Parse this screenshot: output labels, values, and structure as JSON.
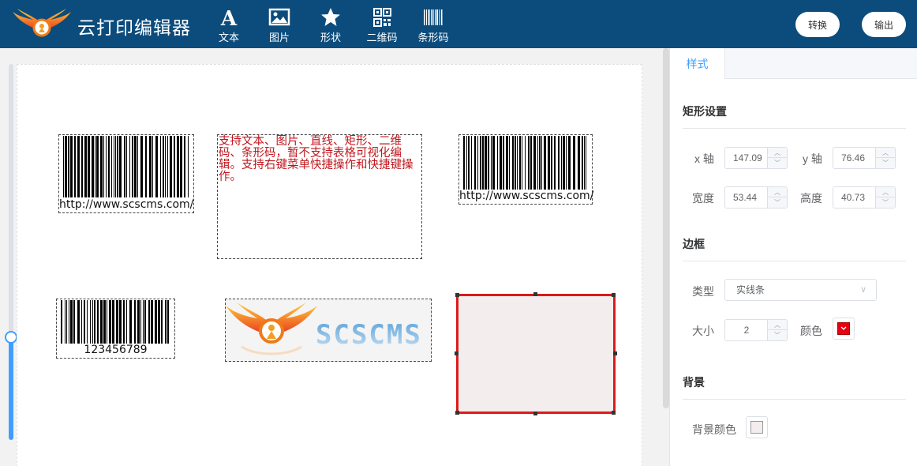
{
  "header": {
    "title": "云打印编辑器",
    "logo_icon": "winged-logo-icon",
    "tools": [
      {
        "label": "文本",
        "icon": "text-icon"
      },
      {
        "label": "图片",
        "icon": "image-icon"
      },
      {
        "label": "形状",
        "icon": "star-icon"
      },
      {
        "label": "二维码",
        "icon": "qrcode-icon"
      },
      {
        "label": "条形码",
        "icon": "barcode-icon"
      }
    ],
    "convert_label": "转换",
    "export_label": "输出",
    "bg_color": "#0c4c7c"
  },
  "canvas": {
    "zoom_slider_level": 0.27,
    "elements": {
      "barcode1_text": "http://www.scscms.com/",
      "text_content": "支持文本、图片、直线、矩形、二维码、条形码，暂不支持表格可视化编辑。支持右键菜单快捷操作和快捷键操作。",
      "barcode2_text": "http://www.scscms.com/",
      "barcode3_text": "123456789",
      "image_logo_text": "SCSCMS",
      "rect_fill": "#f3eded",
      "rect_border": "#dd1a1a"
    }
  },
  "panel": {
    "tab_label": "样式",
    "rect_section": "矩形设置",
    "x_label": "x 轴",
    "x_value": "147.09",
    "y_label": "y 轴",
    "y_value": "76.46",
    "width_label": "宽度",
    "width_value": "53.44",
    "height_label": "高度",
    "height_value": "40.73",
    "border_section": "边框",
    "type_label": "类型",
    "type_value": "实线条",
    "size_label": "大小",
    "size_value": "2",
    "color_label": "颜色",
    "border_color": "#e60012",
    "bg_section": "背景",
    "bg_color_label": "背景颜色",
    "bg_color_value": "#f3eded"
  }
}
